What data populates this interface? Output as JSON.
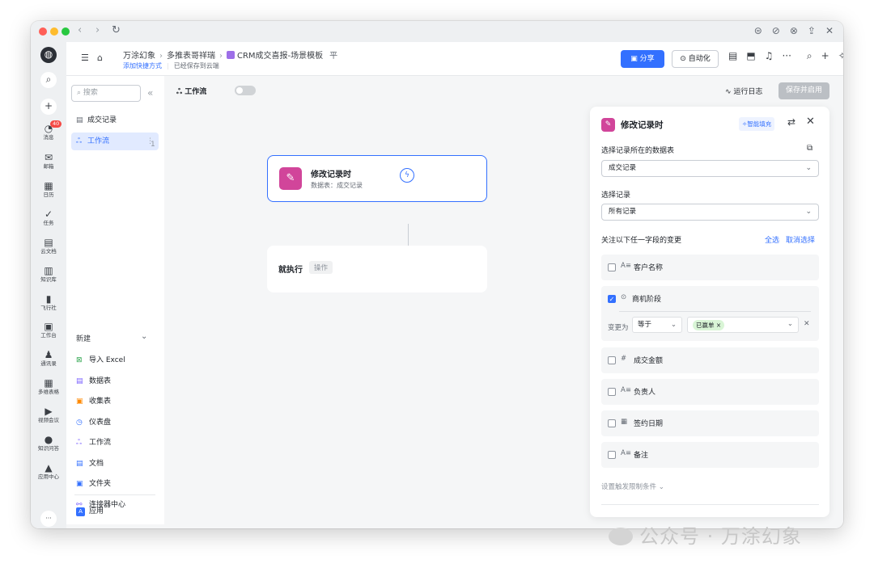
{
  "titlebar": {
    "nav_back": "‹",
    "nav_forward": "›",
    "nav_reload": "↻",
    "icons_right": [
      "⊜",
      "⊘",
      "⊗",
      "⇪",
      "✕"
    ]
  },
  "rail": {
    "items": [
      {
        "label": "消息",
        "icon": "◔",
        "badge": "40"
      },
      {
        "label": "邮箱",
        "icon": "✉"
      },
      {
        "label": "日历",
        "icon": "▦"
      },
      {
        "label": "任务",
        "icon": "✓"
      },
      {
        "label": "云文档",
        "icon": "▤"
      },
      {
        "label": "知识库",
        "icon": "▥"
      },
      {
        "label": "飞行社",
        "icon": "▮"
      },
      {
        "label": "工作台",
        "icon": "▣"
      },
      {
        "label": "通讯录",
        "icon": "♟"
      },
      {
        "label": "多维表格",
        "icon": "▦"
      },
      {
        "label": "视频会议",
        "icon": "▶"
      },
      {
        "label": "知识问答",
        "icon": "●"
      },
      {
        "label": "应用中心",
        "icon": "▲"
      }
    ],
    "search_icon": "⌕",
    "add_icon": "+",
    "more_icon": "···",
    "bottom_icon": "⊻"
  },
  "header": {
    "menu_icon": "☰",
    "home_icon": "⌂",
    "breadcrumb": [
      "万涂幻象",
      "多推表哥祥瑞",
      "CRM成交喜报-场景模板"
    ],
    "pin_icon": "平",
    "shortcut_link": "添加快捷方式",
    "saved_text": "已经保存到云端",
    "share_label": "分享",
    "automation_label": "自动化",
    "tool_icons": [
      "▤",
      "⬒",
      "♫",
      "···",
      "⌕",
      "+",
      "✧"
    ]
  },
  "sidebar": {
    "search_placeholder": "搜索",
    "collapse_icon": "«",
    "items": [
      {
        "label": "成交记录",
        "icon": "▤"
      },
      {
        "label": "工作流",
        "icon": "ஃ"
      }
    ],
    "new_title": "新建",
    "new_items": [
      {
        "label": "导入 Excel",
        "icon": "⊠",
        "color": "#34a853"
      },
      {
        "label": "数据表",
        "icon": "▤",
        "color": "#7b61ff"
      },
      {
        "label": "收集表",
        "icon": "▣",
        "color": "#ff8800"
      },
      {
        "label": "仪表盘",
        "icon": "◷",
        "color": "#3370ff"
      },
      {
        "label": "工作流",
        "icon": "ஃ",
        "color": "#7b61ff"
      },
      {
        "label": "文档",
        "icon": "▤",
        "color": "#3370ff"
      },
      {
        "label": "文件夹",
        "icon": "▣",
        "color": "#3370ff"
      },
      {
        "label": "连接器中心",
        "icon": "⚯",
        "color": "#7b61ff"
      }
    ],
    "app_item": {
      "label": "应用",
      "icon": "A"
    }
  },
  "canvas": {
    "title": "工作流",
    "run_log": "运行日志",
    "save_enable": "保存并启用",
    "node_index": "1",
    "node1": {
      "title": "修改记录时",
      "subtitle": "数据表：成交记录"
    },
    "node2": {
      "title": "就执行",
      "tag": "操作"
    }
  },
  "panel": {
    "title": "修改记录时",
    "smart_fill": "✧智能填充",
    "label_table": "选择记录所在的数据表",
    "table_value": "成交记录",
    "label_record": "选择记录",
    "record_value": "所有记录",
    "label_fields": "关注以下任一字段的变更",
    "select_all": "全选",
    "deselect": "取消选择",
    "fields": [
      {
        "label": "客户名称",
        "icon": "A≡",
        "checked": false
      },
      {
        "label": "商机阶段",
        "icon": "⊙",
        "checked": true
      },
      {
        "label": "成交金额",
        "icon": "#",
        "checked": false
      },
      {
        "label": "负责人",
        "icon": "A≡",
        "checked": false
      },
      {
        "label": "签约日期",
        "icon": "▦",
        "checked": false
      },
      {
        "label": "备注",
        "icon": "A≡",
        "checked": false
      }
    ],
    "condition": {
      "label": "变更为",
      "operator": "等于",
      "value": "已赢单"
    },
    "limit_text": "设置触发限制条件"
  },
  "watermark": "公众号 · 万涂幻象"
}
